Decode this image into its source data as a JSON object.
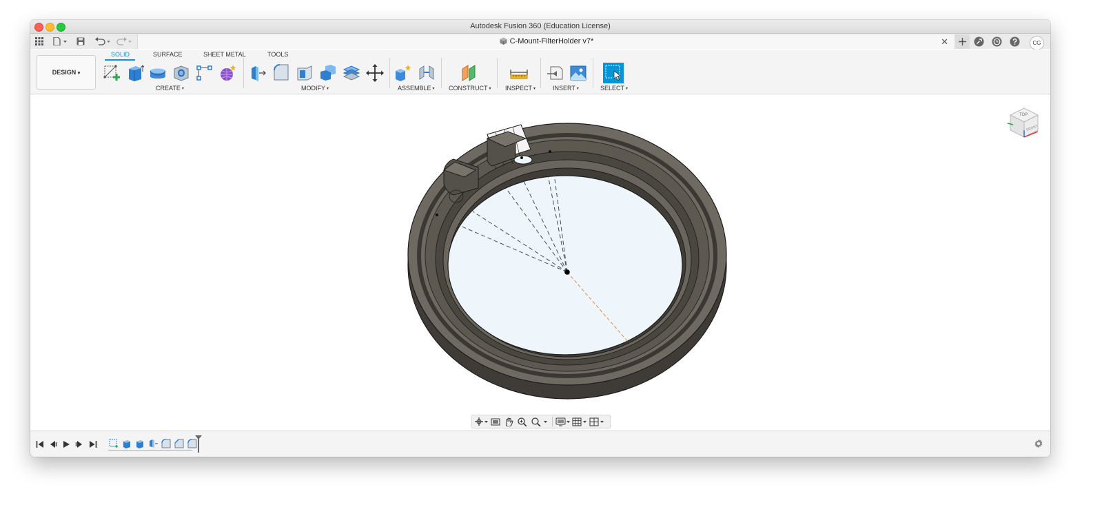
{
  "window": {
    "title": "Autodesk Fusion 360 (Education License)"
  },
  "document": {
    "name": "C-Mount-FilterHolder v7*",
    "close_label": "✕"
  },
  "user": {
    "initials": "CG"
  },
  "toolbar": {
    "workspace_label": "DESIGN",
    "workspace_caret": "▾",
    "tabs": [
      {
        "label": "SOLID",
        "active": true
      },
      {
        "label": "SURFACE",
        "active": false
      },
      {
        "label": "SHEET METAL",
        "active": false
      },
      {
        "label": "TOOLS",
        "active": false
      }
    ],
    "groups": [
      {
        "label": "CREATE"
      },
      {
        "label": "MODIFY"
      },
      {
        "label": "ASSEMBLE"
      },
      {
        "label": "CONSTRUCT"
      },
      {
        "label": "INSPECT"
      },
      {
        "label": "INSERT"
      },
      {
        "label": "SELECT"
      }
    ],
    "caret": "▾"
  },
  "icons": {
    "app_grid": "grid-icon",
    "file": "file-icon",
    "save": "save-icon",
    "undo": "undo-icon",
    "redo": "redo-icon",
    "new_tab": "plus-icon",
    "extensions": "extensions-icon",
    "job_status": "clock-icon",
    "help": "help-icon",
    "settings": "gear-icon"
  },
  "viewcube": {
    "top": "TOP",
    "front": "FRONT"
  },
  "colors": {
    "accent": "#0696d7",
    "model_body": "#5e5a53",
    "glass": "#eef6fb"
  }
}
